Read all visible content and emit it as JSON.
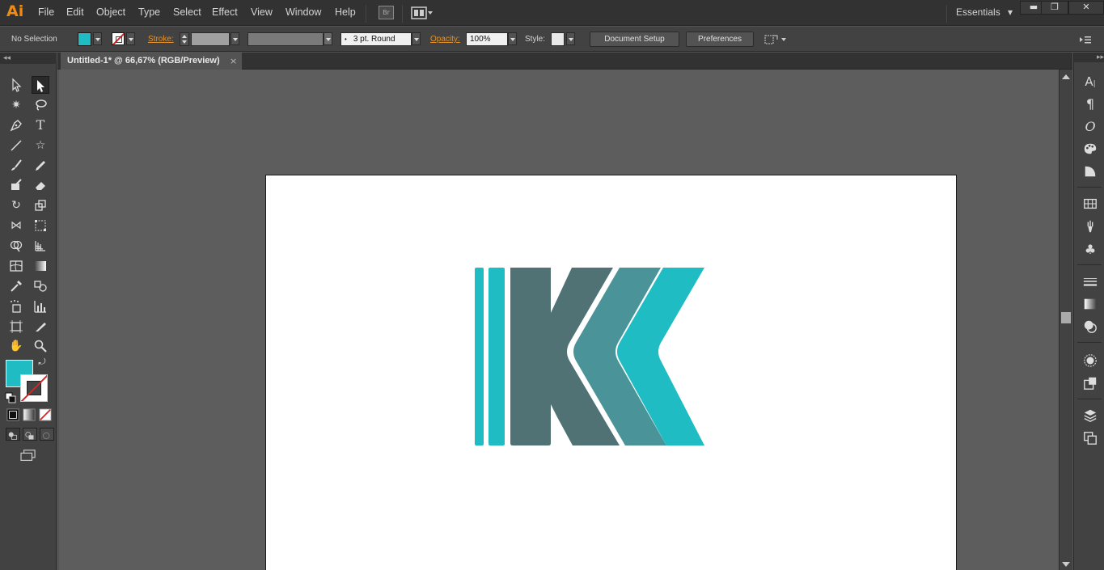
{
  "app": {
    "logo": "Ai"
  },
  "menu": [
    "File",
    "Edit",
    "Object",
    "Type",
    "Select",
    "Effect",
    "View",
    "Window",
    "Help"
  ],
  "bridge_icon": "Br",
  "workspace": {
    "label": "Essentials",
    "arrow": "▾"
  },
  "window_controls": {
    "minimize": "▬",
    "restore": "❐",
    "close": "✕"
  },
  "control_bar": {
    "selection": "No Selection",
    "fill_color": "#1fbcc4",
    "stroke_label": "Stroke:",
    "brush": "3 pt. Round",
    "opacity_label": "Opacity:",
    "opacity_value": "100%",
    "style_label": "Style:",
    "document_setup": "Document Setup",
    "preferences": "Preferences"
  },
  "document": {
    "tab_title": "Untitled-1* @ 66,67% (RGB/Preview)",
    "close": "×"
  },
  "toolbar": {
    "collapse": "◂◂"
  },
  "right_panel": {
    "collapse": "▸▸"
  },
  "artwork": {
    "colors": {
      "bar": "#1fbcc4",
      "k_body": "#507275",
      "chevron_mid": "#4a9499",
      "chevron_light": "#1fbcc4"
    }
  }
}
